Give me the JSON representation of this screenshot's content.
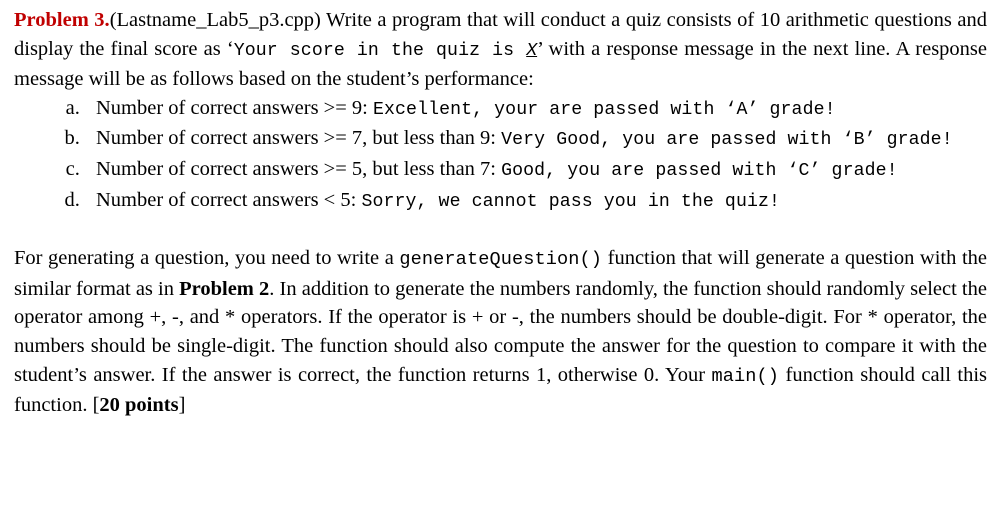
{
  "document": {
    "problem_label": "Problem 3.",
    "accent_color": "#c00000",
    "intro": {
      "filename_part": "(Lastname_Lab5_p3.cpp) Write a program that will conduct a quiz consists of 10 arithmetic questions and display the final score as ‘",
      "code_output": "Your score in the quiz is ",
      "code_variable": "X",
      "after_code": "’ with a response message in the next line. A response message will be as follows based on the student’s performance:"
    },
    "answer_list": [
      {
        "condition": "Number of correct answers >= 9: ",
        "message": "Excellent, your are passed with ‘A’ grade!"
      },
      {
        "condition": "Number of correct answers >= 7, but less than 9: ",
        "message": "Very Good, you are passed with ‘B’ grade!"
      },
      {
        "condition": "Number of correct answers >= 5, but less than 7: ",
        "message": "Good, you are passed with ‘C’ grade!"
      },
      {
        "condition": "Number of correct answers < 5: ",
        "message": "Sorry, we cannot pass you in the quiz!"
      }
    ],
    "body": {
      "text_1": "For generating a question, you need to write a ",
      "code_1": "generateQuestion()",
      "text_2": " function that will generate a question with the similar format as in ",
      "bold_1": "Problem 2",
      "text_3": ". In addition to generate the numbers randomly, the function should randomly select the operator among +, -, and * operators. If the operator is + or -, the numbers should be double-digit. For * operator, the numbers should be single-digit. The function should also compute the answer for the question to compare it with the student’s answer. If the answer is correct, the function returns 1, otherwise 0. Your ",
      "code_2": "main()",
      "text_4": " function should call this function. [",
      "points": "20 points",
      "text_5": "]"
    }
  }
}
